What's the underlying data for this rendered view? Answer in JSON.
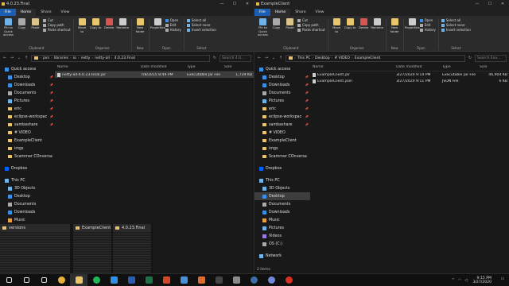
{
  "left": {
    "title": "4.0.23.Final",
    "tabs": [
      "File",
      "Home",
      "Share",
      "View"
    ],
    "ribbon": {
      "clipboard": {
        "label": "Clipboard",
        "pin": "Pin to Quick access",
        "copy": "Copy",
        "paste": "Paste",
        "cut": "Cut",
        "copy_path": "Copy path",
        "paste_shortcut": "Paste shortcut"
      },
      "organize": {
        "label": "Organize",
        "move_to": "Move to",
        "copy_to": "Copy to",
        "delete": "Delete",
        "rename": "Rename"
      },
      "new": {
        "label": "New",
        "new_folder": "New folder"
      },
      "open": {
        "label": "Open",
        "properties": "Properties",
        "open": "Open",
        "edit": "Edit",
        "history": "History"
      },
      "select": {
        "label": "Select",
        "select_all": "Select all",
        "select_none": "Select none",
        "invert": "Invert selection"
      }
    },
    "path": [
      "jars",
      "libraries",
      "io",
      "netty",
      "netty-all",
      "4.0.23.Final"
    ],
    "search_placeholder": "Search 4.0...",
    "nav": [
      {
        "label": "Quick access",
        "icon": "star-icon",
        "kind": "root"
      },
      {
        "label": "Desktop",
        "icon": "desktop-icon",
        "pin": true
      },
      {
        "label": "Downloads",
        "icon": "download-icon",
        "pin": true
      },
      {
        "label": "Documents",
        "icon": "documents-icon",
        "pin": true
      },
      {
        "label": "Pictures",
        "icon": "pictures-icon",
        "pin": true
      },
      {
        "label": "eric",
        "icon": "folder-icon",
        "pin": true
      },
      {
        "label": "eclipse-workspac",
        "icon": "folder-icon",
        "pin": true
      },
      {
        "label": "sambashare",
        "icon": "folder-icon",
        "pin": true
      },
      {
        "label": "# VIDEO",
        "icon": "folder-icon"
      },
      {
        "label": "ExampleClient",
        "icon": "folder-icon"
      },
      {
        "label": "imgs",
        "icon": "folder-icon"
      },
      {
        "label": "Scammer COnversa",
        "icon": "folder-icon"
      },
      {
        "label": "",
        "icon": "spacer"
      },
      {
        "label": "Dropbox",
        "icon": "dropbox-icon",
        "kind": "root"
      },
      {
        "label": "",
        "icon": "spacer"
      },
      {
        "label": "This PC",
        "icon": "pc-icon",
        "kind": "root"
      },
      {
        "label": "3D Objects",
        "icon": "cube-icon"
      },
      {
        "label": "Desktop",
        "icon": "desktop-icon"
      },
      {
        "label": "Documents",
        "icon": "documents-icon"
      },
      {
        "label": "Downloads",
        "icon": "download-icon"
      },
      {
        "label": "Music",
        "icon": "music-icon"
      }
    ],
    "columns": [
      "Name",
      "Date modified",
      "Type",
      "Size"
    ],
    "files": [
      {
        "name": "netty-all-4.0.23.Final.jar",
        "date": "7/8/2015 8:49 PM",
        "type": "Executable Jar File",
        "size": "1,739 KB",
        "selected": true
      }
    ],
    "thumbs": [
      {
        "title": "versions"
      },
      {
        "title": "ExampleClient"
      },
      {
        "title": "4.0.23.Final"
      }
    ]
  },
  "right": {
    "title": "ExampleClient",
    "tabs": [
      "File",
      "Home",
      "Share",
      "View"
    ],
    "ribbon": {
      "clipboard": {
        "label": "Clipboard",
        "pin": "Pin to Quick access",
        "copy": "Copy",
        "paste": "Paste",
        "cut": "Cut",
        "copy_path": "Copy path",
        "paste_shortcut": "Paste shortcut"
      },
      "organize": {
        "label": "Organize",
        "move_to": "Move to",
        "copy_to": "Copy to",
        "delete": "Delete",
        "rename": "Rename"
      },
      "new": {
        "label": "New",
        "new_folder": "New folder"
      },
      "open": {
        "label": "Open",
        "properties": "Properties",
        "open": "Open",
        "edit": "Edit",
        "history": "History"
      },
      "select": {
        "label": "Select",
        "select_all": "Select all",
        "select_none": "Select none",
        "invert": "Invert selection"
      }
    },
    "path": [
      "This PC",
      "Desktop",
      "# VIDEO",
      "ExampleClient"
    ],
    "search_placeholder": "Search Exa...",
    "nav": [
      {
        "label": "Quick access",
        "icon": "star-icon",
        "kind": "root"
      },
      {
        "label": "Desktop",
        "icon": "desktop-icon",
        "pin": true
      },
      {
        "label": "Downloads",
        "icon": "download-icon",
        "pin": true
      },
      {
        "label": "Documents",
        "icon": "documents-icon",
        "pin": true
      },
      {
        "label": "Pictures",
        "icon": "pictures-icon",
        "pin": true
      },
      {
        "label": "eric",
        "icon": "folder-icon",
        "pin": true
      },
      {
        "label": "eclipse-workspac",
        "icon": "folder-icon",
        "pin": true
      },
      {
        "label": "sambashare",
        "icon": "folder-icon",
        "pin": true
      },
      {
        "label": "# VIDEO",
        "icon": "folder-icon"
      },
      {
        "label": "ExampleClient",
        "icon": "folder-icon"
      },
      {
        "label": "imgs",
        "icon": "folder-icon"
      },
      {
        "label": "Scammer COnversa",
        "icon": "folder-icon"
      },
      {
        "label": "",
        "icon": "spacer"
      },
      {
        "label": "Dropbox",
        "icon": "dropbox-icon",
        "kind": "root"
      },
      {
        "label": "",
        "icon": "spacer"
      },
      {
        "label": "This PC",
        "icon": "pc-icon",
        "kind": "root"
      },
      {
        "label": "3D Objects",
        "icon": "cube-icon"
      },
      {
        "label": "Desktop",
        "icon": "desktop-icon",
        "selected": true
      },
      {
        "label": "Documents",
        "icon": "documents-icon"
      },
      {
        "label": "Downloads",
        "icon": "download-icon"
      },
      {
        "label": "Music",
        "icon": "music-icon"
      },
      {
        "label": "Pictures",
        "icon": "pictures-icon"
      },
      {
        "label": "Videos",
        "icon": "video-icon"
      },
      {
        "label": "OS (C:)",
        "icon": "drive-icon"
      },
      {
        "label": "",
        "icon": "spacer"
      },
      {
        "label": "Network",
        "icon": "network-icon",
        "kind": "root"
      }
    ],
    "columns": [
      "Name",
      "Date modified",
      "Type",
      "Size"
    ],
    "files": [
      {
        "name": "ExampleClient.jar",
        "date": "3/27/2020 9:14 PM",
        "type": "Executable Jar File",
        "size": "46,904 KB"
      },
      {
        "name": "ExampleClient.json",
        "date": "3/27/2020 9:11 PM",
        "type": "JSON File",
        "size": "6 KB"
      }
    ],
    "status": "2 items"
  },
  "taskbar": {
    "icons": [
      "start-icon",
      "search-icon",
      "taskview-icon",
      "chrome-icon",
      "explorer-icon",
      "spotify-icon",
      "vscode-icon",
      "word-icon",
      "excel-icon",
      "powerpoint-icon",
      "photos-icon",
      "java-icon",
      "obs-icon",
      "app-icon",
      "steam-icon",
      "discord-icon",
      "record-icon"
    ],
    "time": "9:15 PM",
    "date": "3/27/2020"
  },
  "colors": {
    "folder": "#e8c46a",
    "accent": "#1a5fb4",
    "bg": "#191919",
    "ribbon": "#2b2b2b"
  }
}
